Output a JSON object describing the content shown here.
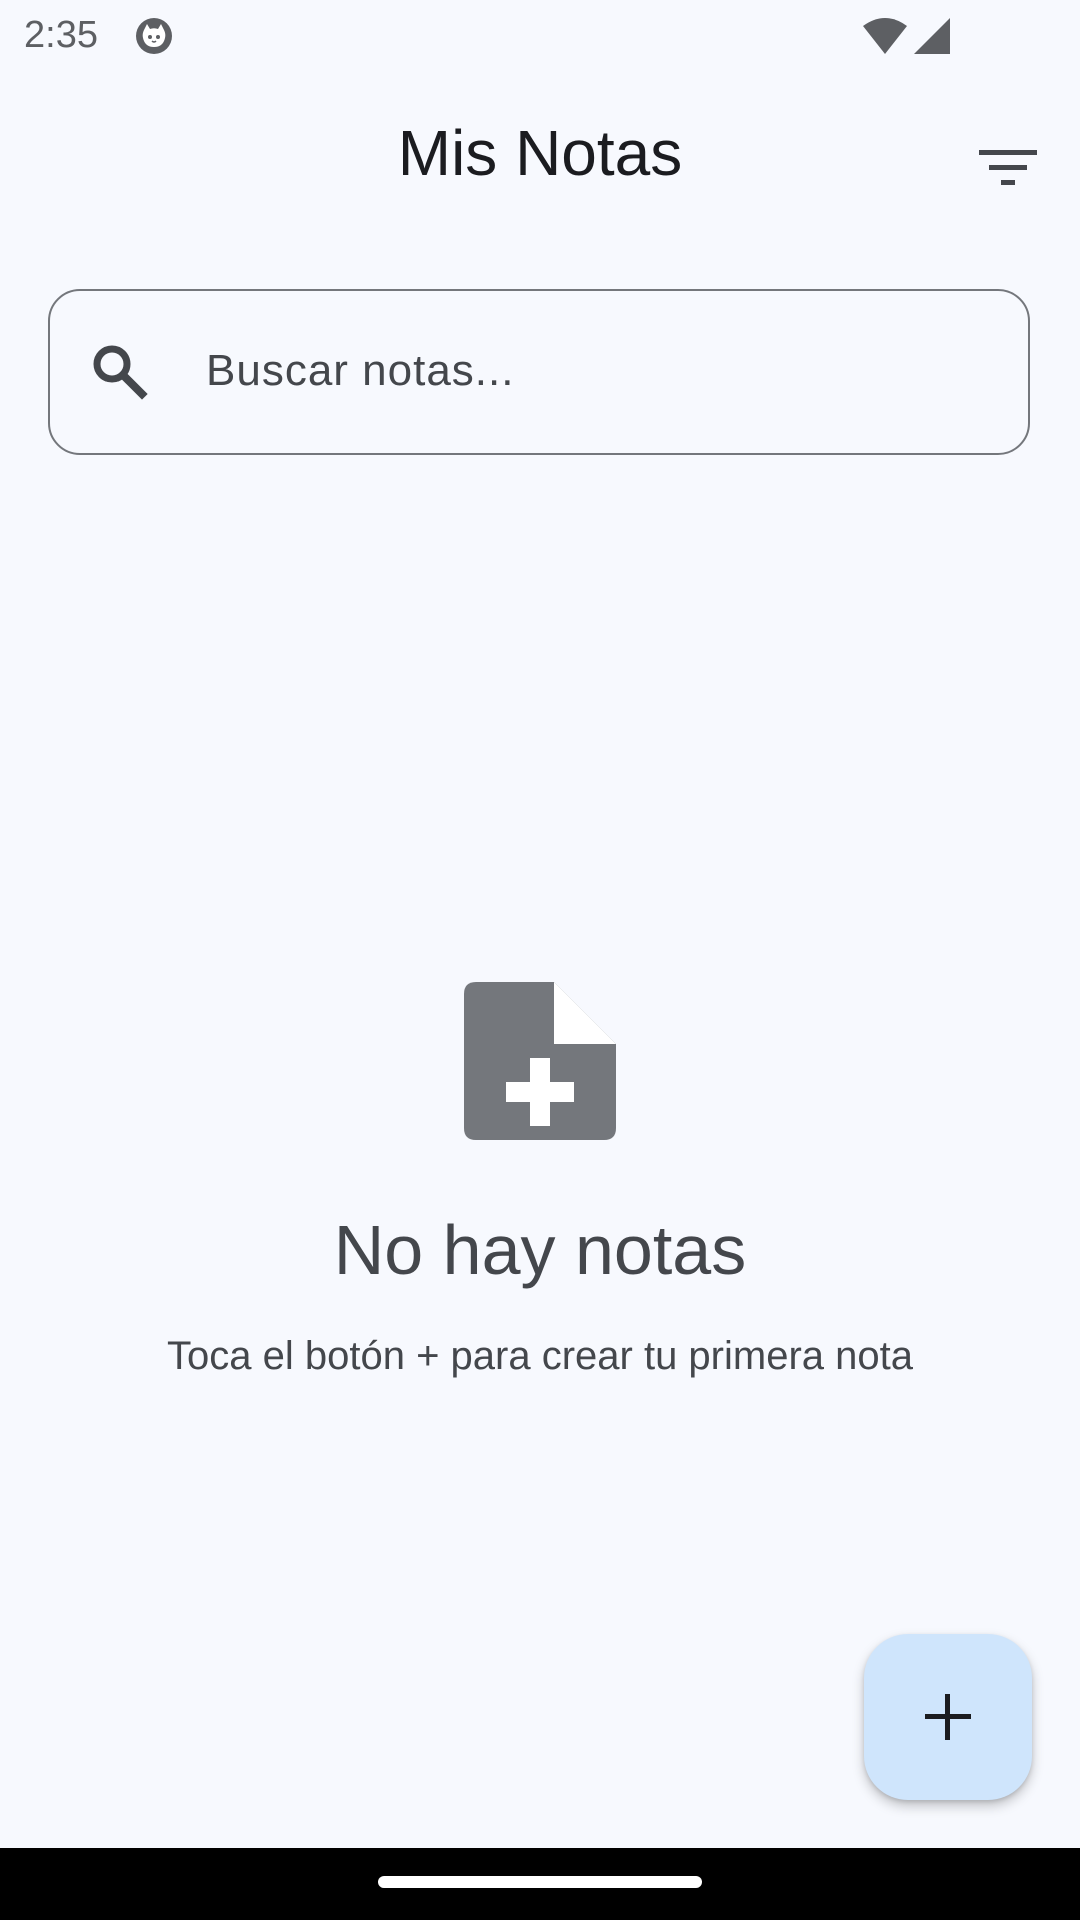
{
  "status_bar": {
    "time": "2:35",
    "icons": [
      "app-notification-icon",
      "wifi-icon",
      "cell-signal-icon"
    ]
  },
  "app_bar": {
    "title": "Mis Notas",
    "filter_icon": "filter-list-icon"
  },
  "search": {
    "placeholder": "Buscar notas...",
    "value": "",
    "icon": "search-icon"
  },
  "empty_state": {
    "icon": "note-add-icon",
    "title": "No hay notas",
    "subtitle": "Toca el botón + para crear tu primera nota"
  },
  "fab": {
    "icon": "add-icon"
  },
  "colors": {
    "background": "#f7f9fe",
    "fab_background": "#cfe5fc",
    "empty_icon": "#74777c",
    "text_secondary": "#44474c"
  }
}
